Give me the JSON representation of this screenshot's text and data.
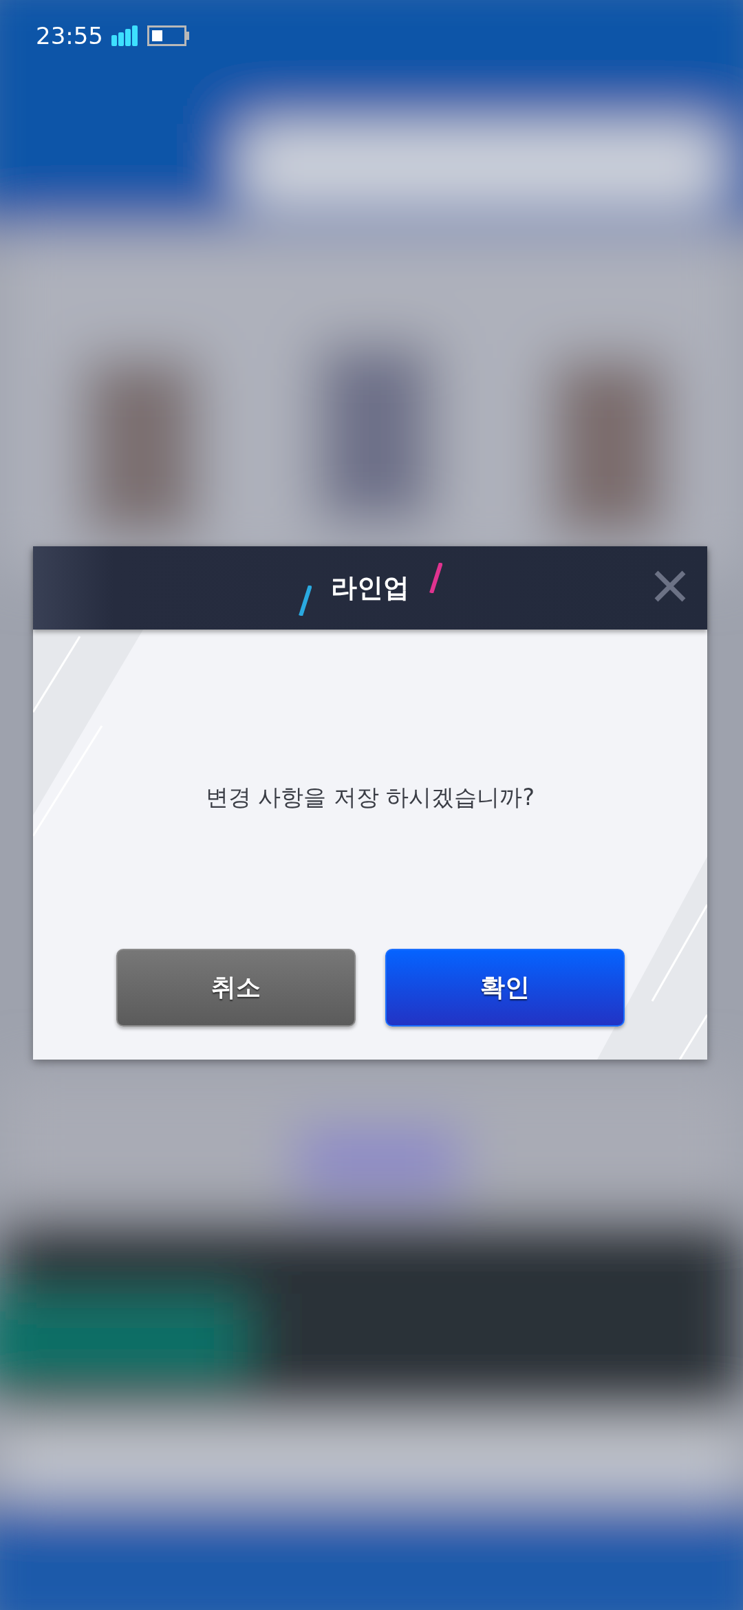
{
  "status_bar": {
    "time": "23:55"
  },
  "dialog": {
    "title": "라인업",
    "message": "변경 사항을 저장 하시겠습니까?",
    "buttons": [
      {
        "label": "취소",
        "kind": "cancel"
      },
      {
        "label": "확인",
        "kind": "confirm"
      }
    ]
  }
}
